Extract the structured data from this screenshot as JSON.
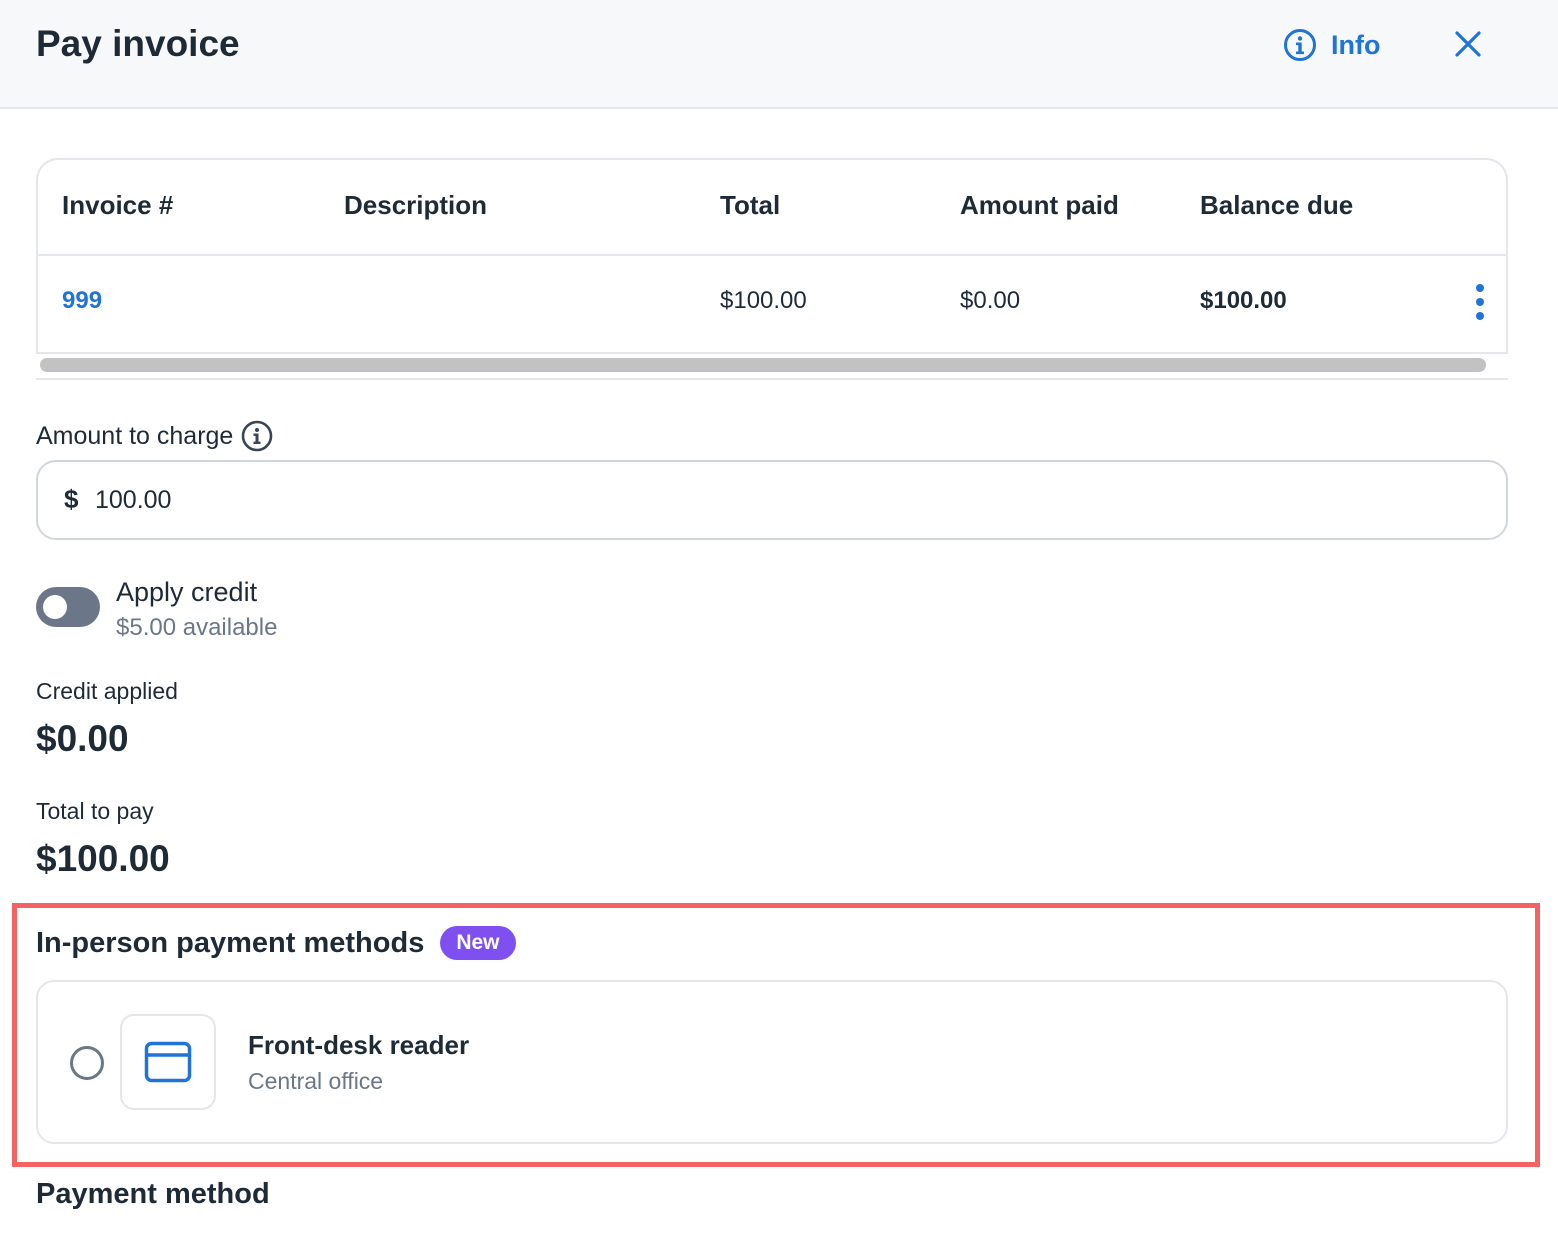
{
  "header": {
    "title": "Pay invoice",
    "info_label": "Info"
  },
  "table": {
    "columns": [
      "Invoice #",
      "Description",
      "Total",
      "Amount paid",
      "Balance due"
    ],
    "rows": [
      {
        "invoice": "999",
        "description": "",
        "total": "$100.00",
        "amount_paid": "$0.00",
        "balance_due": "$100.00"
      }
    ]
  },
  "amount": {
    "label": "Amount to charge",
    "currency": "$",
    "value": "100.00"
  },
  "credit": {
    "title": "Apply credit",
    "available": "$5.00 available",
    "enabled": false
  },
  "summary": {
    "credit_applied_label": "Credit applied",
    "credit_applied_value": "$0.00",
    "total_label": "Total to pay",
    "total_value": "$100.00"
  },
  "in_person": {
    "title": "In-person payment methods",
    "badge": "New",
    "methods": [
      {
        "name": "Front-desk reader",
        "location": "Central office",
        "icon": "credit-card-icon",
        "selected": false
      }
    ]
  },
  "payment_method": {
    "title": "Payment method"
  },
  "colors": {
    "accent": "#1f74d6",
    "badge": "#7f4ff0",
    "highlight": "#f26363",
    "muted": "#6b7788"
  }
}
